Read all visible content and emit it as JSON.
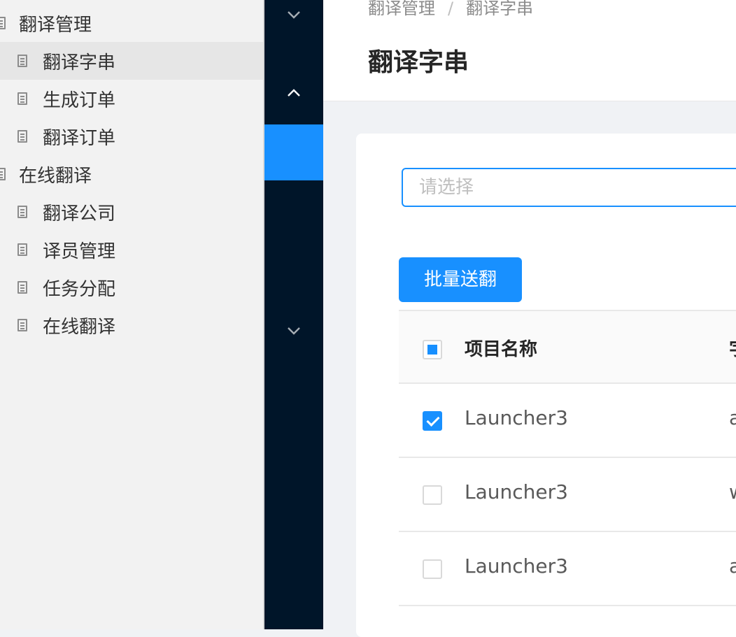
{
  "tree": {
    "items": [
      {
        "label": "翻译管理",
        "level": 1,
        "selected": false
      },
      {
        "label": "翻译字串",
        "level": 2,
        "selected": true
      },
      {
        "label": "生成订单",
        "level": 2,
        "selected": false
      },
      {
        "label": "翻译订单",
        "level": 2,
        "selected": false
      },
      {
        "label": "在线翻译",
        "level": 1,
        "selected": false
      },
      {
        "label": "翻译公司",
        "level": 2,
        "selected": false
      },
      {
        "label": "译员管理",
        "level": 2,
        "selected": false
      },
      {
        "label": "任务分配",
        "level": 2,
        "selected": false
      },
      {
        "label": "在线翻译",
        "level": 2,
        "selected": false
      }
    ]
  },
  "header": {
    "breadcrumb": [
      "翻译管理",
      "翻译字串"
    ],
    "breadcrumb_sep": "/",
    "title": "翻译字串"
  },
  "filter": {
    "placeholder": "请选择"
  },
  "toolbar": {
    "batch_label": "批量送翻"
  },
  "table": {
    "header_checkbox": "indeterminate",
    "columns": [
      "项目名称",
      "字"
    ],
    "rows": [
      {
        "checked": true,
        "name": "Launcher3",
        "col2": "a"
      },
      {
        "checked": false,
        "name": "Launcher3",
        "col2": "w"
      },
      {
        "checked": false,
        "name": "Launcher3",
        "col2": "a"
      }
    ]
  },
  "colors": {
    "accent": "#1890ff",
    "sider": "#001529"
  }
}
